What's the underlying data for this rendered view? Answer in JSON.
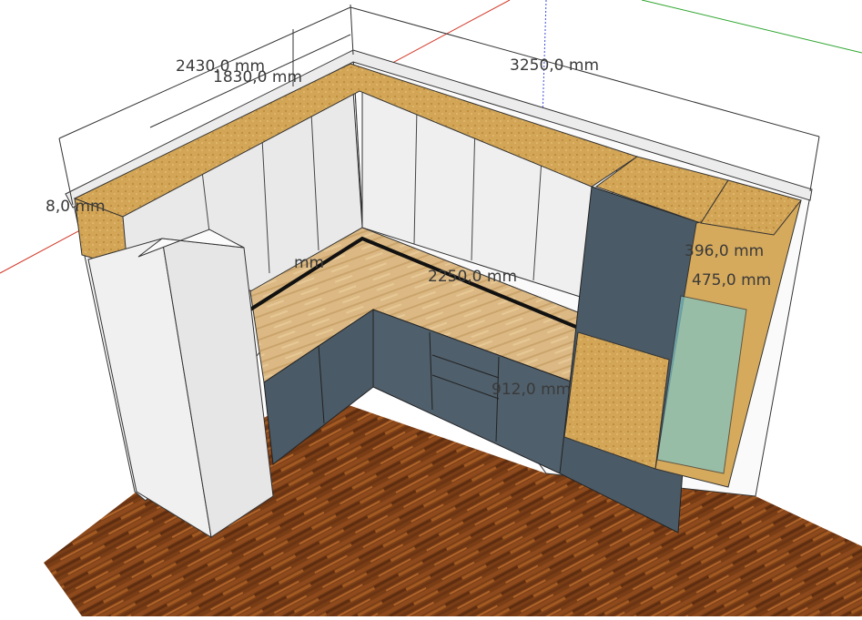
{
  "scene": {
    "dimensions": {
      "d1": "2430,0 mm",
      "d2": "1830,0 mm",
      "d3": "3250,0 mm",
      "d4": "8,0 mm",
      "d5": "mm",
      "d6": "2250,0 mm",
      "d7": "396,0 mm",
      "d8": "475,0 mm",
      "d9": "912,0 mm"
    },
    "colors": {
      "floor": "#7a3e16",
      "worktop": "#d9b57f",
      "board_top": "#d2a24f",
      "lower_cabinet": "#4a5a66",
      "upper_cabinet": "#eeeeee",
      "wall": "#f7f7f7",
      "axis_red": "#d23a2a",
      "axis_green": "#2ea52e",
      "axis_blue": "#3a4fd8",
      "glass": "#7fc6c8"
    }
  }
}
